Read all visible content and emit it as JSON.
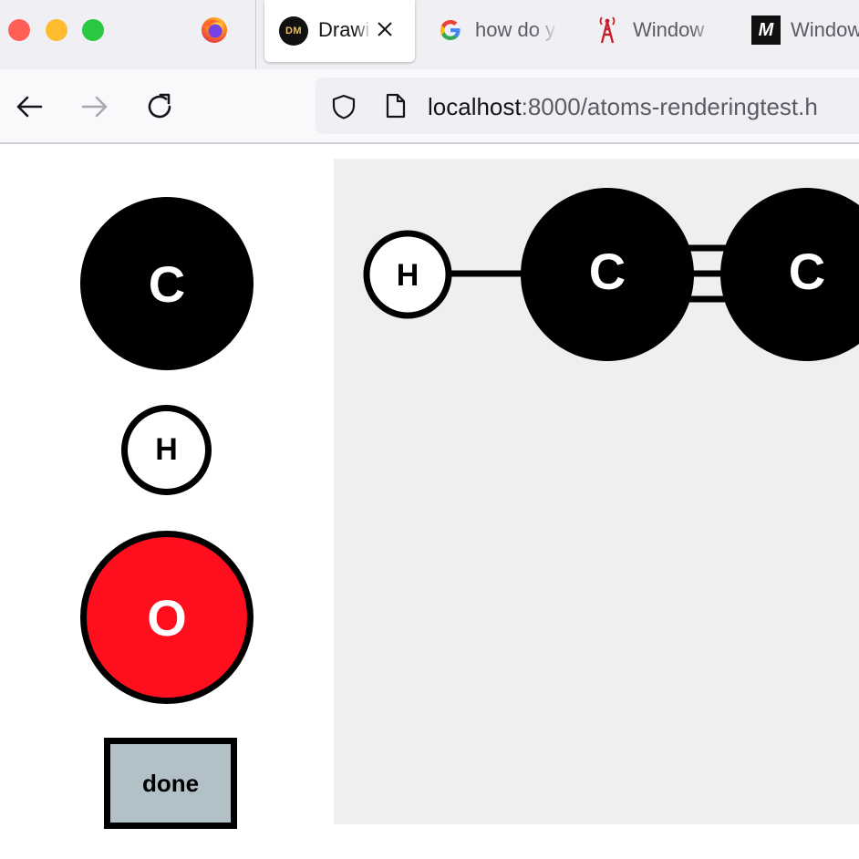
{
  "window": {
    "controls": [
      "close",
      "minimize",
      "maximize"
    ]
  },
  "tabs": [
    {
      "label": "Drawi",
      "icon": "dm-logo-icon",
      "icon_text": "DM",
      "active": true
    },
    {
      "label": "how do y",
      "icon": "google-icon",
      "active": false
    },
    {
      "label": "Window",
      "icon": "tower-icon",
      "active": false
    },
    {
      "label": "Window",
      "icon": "m-logo-icon",
      "icon_text": "M",
      "active": false
    }
  ],
  "navbar": {
    "url_host": "localhost",
    "url_rest": ":8000/atoms-renderingtest.h"
  },
  "palette": {
    "atoms": [
      {
        "symbol": "C",
        "color": "#000000",
        "text_color": "#ffffff"
      },
      {
        "symbol": "H",
        "color": "#ffffff",
        "text_color": "#000000"
      },
      {
        "symbol": "O",
        "color": "#ff0f1e",
        "text_color": "#ffffff"
      }
    ],
    "done_label": "done"
  },
  "canvas": {
    "background": "#efeff0",
    "atoms": [
      {
        "symbol": "H"
      },
      {
        "symbol": "C"
      },
      {
        "symbol": "C"
      }
    ],
    "bonds": [
      {
        "from": "H",
        "to": "C",
        "order": 1
      },
      {
        "from": "C",
        "to": "C",
        "order": 3
      }
    ]
  }
}
